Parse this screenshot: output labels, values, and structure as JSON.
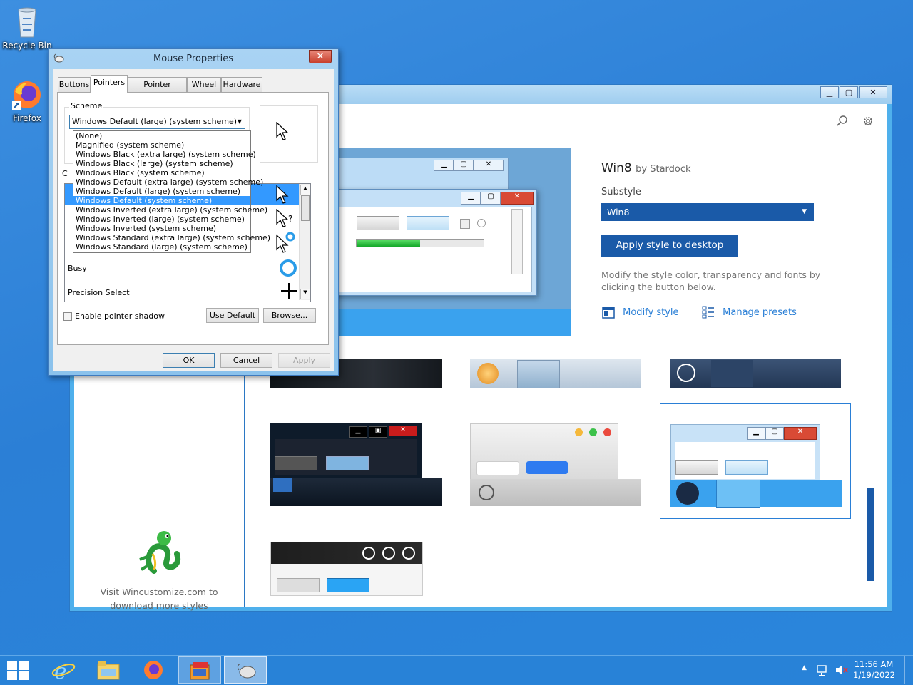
{
  "desktop": {
    "icons": [
      {
        "label": "Recycle Bin",
        "icon": "recycle-bin-icon"
      },
      {
        "label": "Firefox",
        "icon": "firefox-icon"
      }
    ]
  },
  "stardock": {
    "title": "",
    "product_name": "Win8",
    "by_label": "by Stardock",
    "substyle_label": "Substyle",
    "substyle_value": "Win8",
    "apply_button": "Apply style to desktop",
    "description": "Modify the style color, transparency and fonts by clicking the button below.",
    "modify_style": "Modify style",
    "manage_presets": "Manage presets",
    "visit_text_line1": "Visit Wincustomize.com to",
    "visit_text_line2": "download more styles",
    "colors": {
      "accent": "#1a5aa8",
      "link": "#2a7fd6"
    }
  },
  "mouse_properties": {
    "title": "Mouse Properties",
    "tabs": [
      "Buttons",
      "Pointers",
      "Pointer Options",
      "Wheel",
      "Hardware"
    ],
    "active_tab": "Pointers",
    "scheme_label": "Scheme",
    "scheme_selected": "Windows Default (large) (system scheme)",
    "scheme_options": [
      "(None)",
      "Magnified (system scheme)",
      "Windows Black (extra large) (system scheme)",
      "Windows Black (large) (system scheme)",
      "Windows Black (system scheme)",
      "Windows Default (extra large) (system scheme)",
      "Windows Default (large) (system scheme)",
      "Windows Default (system scheme)",
      "Windows Inverted (extra large) (system scheme)",
      "Windows Inverted (large) (system scheme)",
      "Windows Inverted (system scheme)",
      "Windows Standard (extra large) (system scheme)",
      "Windows Standard (large) (system scheme)"
    ],
    "highlighted_option_index": 7,
    "customize_label": "C",
    "pointer_rows": [
      "Busy",
      "Precision Select"
    ],
    "enable_shadow_label": "Enable pointer shadow",
    "enable_shadow_checked": false,
    "use_default_button": "Use Default",
    "browse_button": "Browse...",
    "ok_button": "OK",
    "cancel_button": "Cancel",
    "apply_button": "Apply"
  },
  "taskbar": {
    "time": "11:56 AM",
    "date": "1/19/2022",
    "pinned": [
      "start-icon",
      "internet-explorer-icon",
      "file-explorer-icon",
      "firefox-icon",
      "stardock-app-icon",
      "mouse-properties-icon"
    ]
  }
}
